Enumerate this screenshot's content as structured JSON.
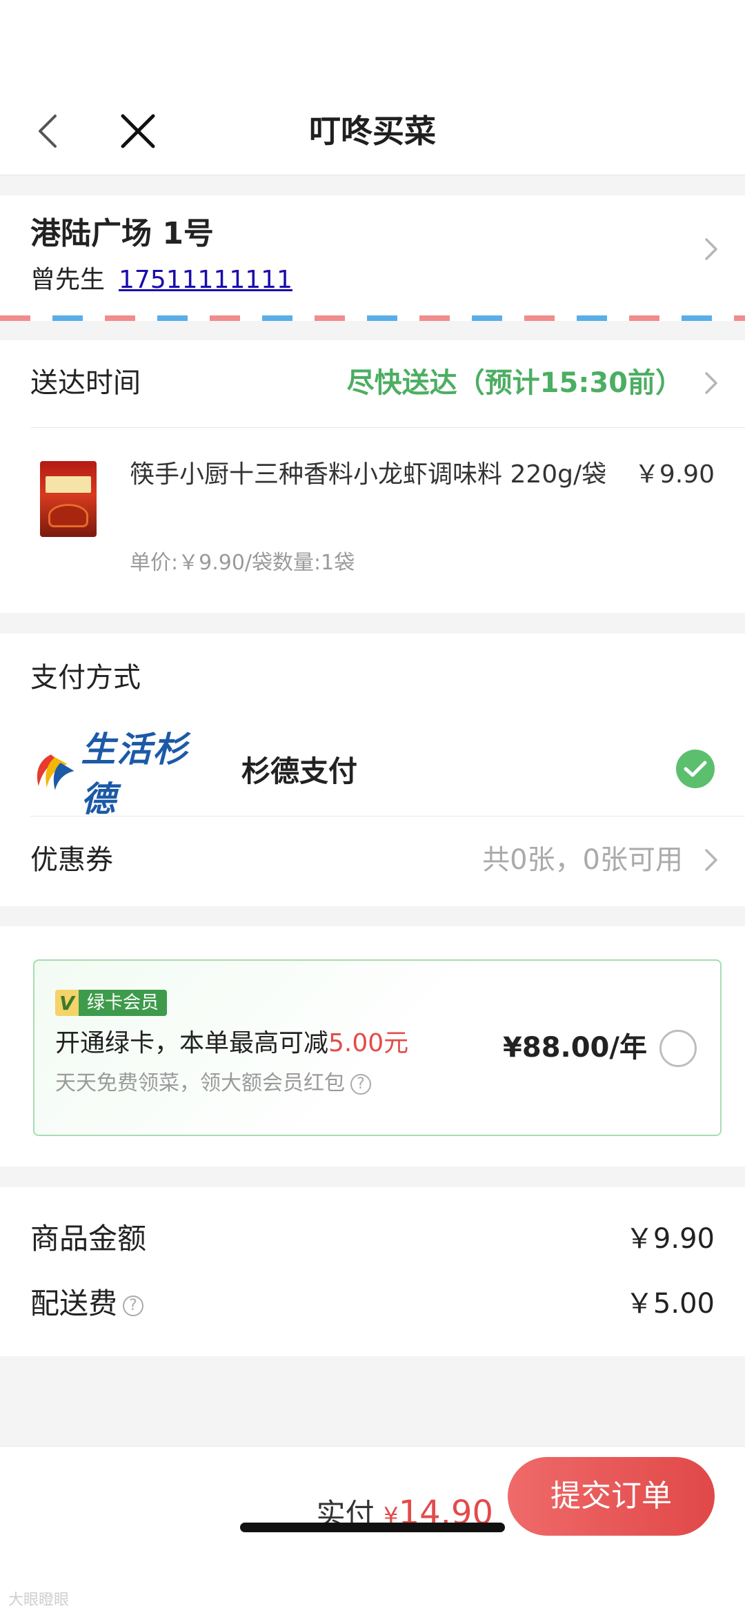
{
  "nav": {
    "title": "叮咚买菜"
  },
  "address": {
    "title": "港陆广场 1号",
    "name": "曾先生",
    "phone": "17511111111"
  },
  "delivery": {
    "label": "送达时间",
    "value": "尽快送达（预计15:30前）",
    "product": {
      "name": "筷手小厨十三种香料小龙虾调味料 220g/袋",
      "price": "￥9.90",
      "meta": "单价:￥9.90/袋数量:1袋"
    }
  },
  "payment": {
    "label": "支付方式",
    "logo_text": "生活杉德",
    "method": "杉德支付",
    "coupon_label": "优惠券",
    "coupon_value": "共0张，0张可用"
  },
  "member": {
    "badge_v": "V",
    "badge": "绿卡会员",
    "text_prefix": "开通绿卡，本单最高可减",
    "discount": "5.00元",
    "subtext": "天天免费领菜，领大额会员红包",
    "price": "¥88.00/年"
  },
  "totals": {
    "goods_label": "商品金额",
    "goods_value": "￥9.90",
    "delivery_label": "配送费",
    "delivery_value": "￥5.00"
  },
  "footer": {
    "pay_label": "实付",
    "currency": "¥",
    "amount": "14.90",
    "submit": "提交订单",
    "watermark": "大眼瞪眼"
  },
  "colors": {
    "accent_green": "#4cae62",
    "accent_red": "#e24b4b",
    "link_blue": "#1a0dab"
  },
  "icons": [
    "back-icon",
    "close-icon",
    "chevron-right-icon",
    "check-icon",
    "question-icon",
    "radio-icon"
  ]
}
